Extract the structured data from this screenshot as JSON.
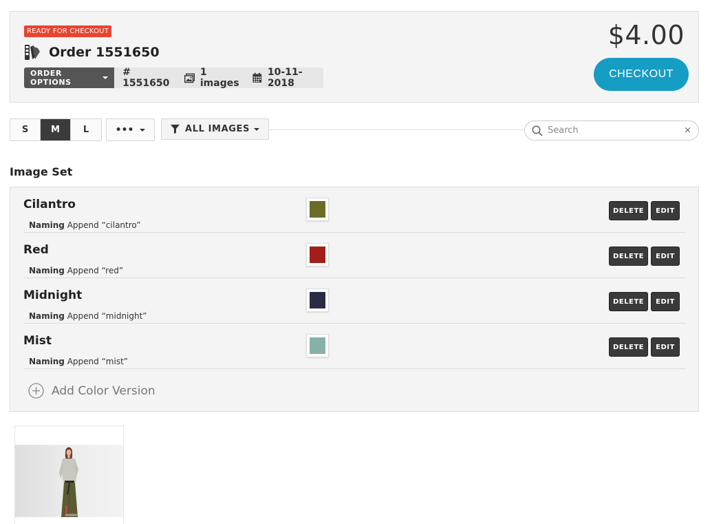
{
  "order": {
    "status_badge": "READY FOR CHECKOUT",
    "title": "Order 1551650",
    "options_label": "ORDER OPTIONS",
    "order_number": "# 1551650",
    "images_count": "1 images",
    "date": "10-11-2018",
    "price": "$4.00",
    "checkout_label": "CHECKOUT"
  },
  "toolbar": {
    "sizes": [
      "S",
      "M",
      "L"
    ],
    "active_size": "M",
    "more_label": "•••",
    "filter_label": "ALL IMAGES",
    "search_placeholder": "Search",
    "search_clear": "×"
  },
  "image_set": {
    "title": "Image Set",
    "naming_label": "Naming",
    "delete_label": "DELETE",
    "edit_label": "EDIT",
    "add_label": "Add Color Version",
    "colors": [
      {
        "name": "Cilantro",
        "naming": "Append “cilantro”",
        "swatch": "#6b6c25"
      },
      {
        "name": "Red",
        "naming": "Append “red”",
        "swatch": "#a31d1a"
      },
      {
        "name": "Midnight",
        "naming": "Append “midnight”",
        "swatch": "#2c2b45"
      },
      {
        "name": "Mist",
        "naming": "Append “mist”",
        "swatch": "#86b1a9"
      }
    ]
  },
  "colors": {
    "badge": "#e8442f",
    "checkout": "#169dc4",
    "dark_button": "#3a3a3a"
  }
}
